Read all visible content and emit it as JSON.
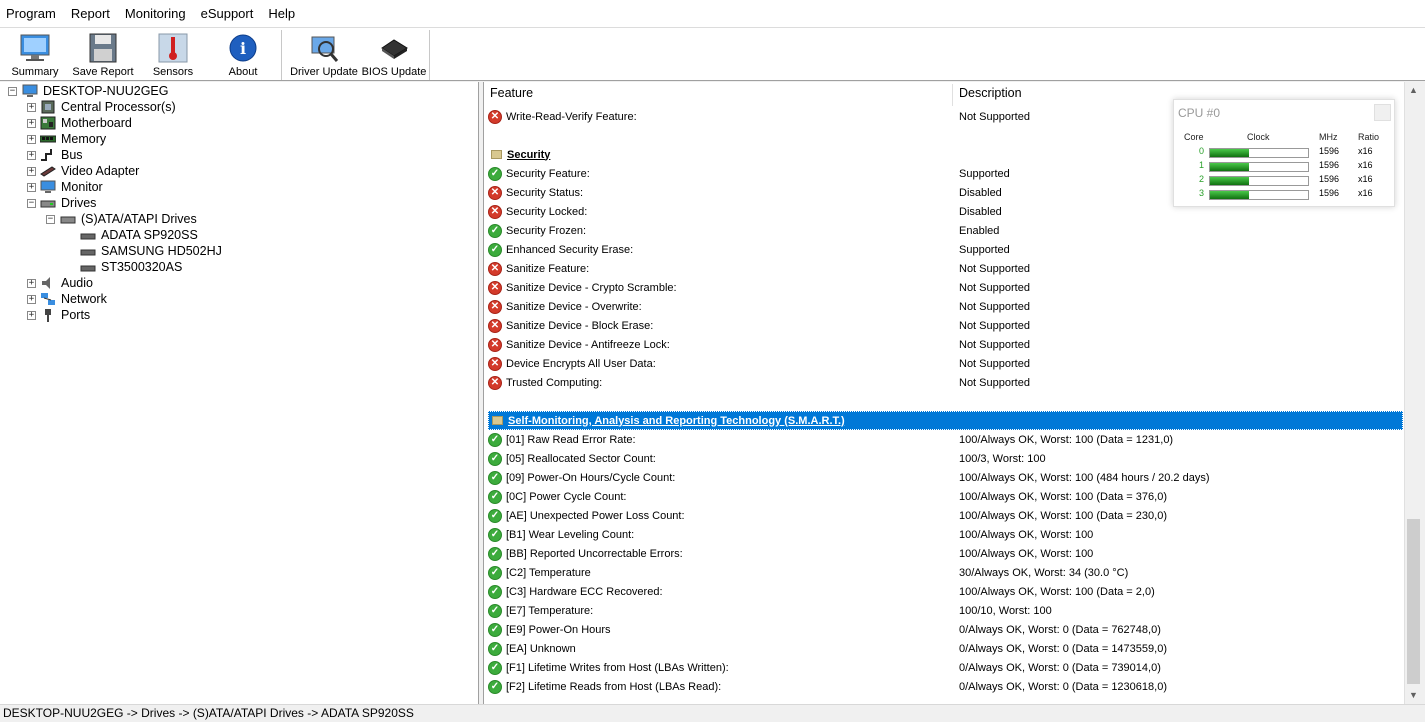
{
  "menu": [
    "Program",
    "Report",
    "Monitoring",
    "eSupport",
    "Help"
  ],
  "toolbar": {
    "summary": "Summary",
    "save_report": "Save Report",
    "sensors": "Sensors",
    "about": "About",
    "driver_update": "Driver Update",
    "bios_update": "BIOS Update"
  },
  "tree": {
    "root": "DESKTOP-NUU2GEG",
    "items": [
      "Central Processor(s)",
      "Motherboard",
      "Memory",
      "Bus",
      "Video Adapter",
      "Monitor",
      "Drives",
      "Audio",
      "Network",
      "Ports"
    ],
    "drives_group": "(S)ATA/ATAPI Drives",
    "drives": [
      "ADATA SP920SS",
      "SAMSUNG HD502HJ",
      "ST3500320AS"
    ]
  },
  "detail": {
    "col_feature": "Feature",
    "col_description": "Description",
    "rows": [
      {
        "status": "bad",
        "feature": "Write-Read-Verify Feature:",
        "description": "Not Supported"
      },
      {
        "status": "section",
        "feature": "Security",
        "description": ""
      },
      {
        "status": "ok",
        "feature": "Security Feature:",
        "description": "Supported"
      },
      {
        "status": "bad",
        "feature": "Security Status:",
        "description": "Disabled"
      },
      {
        "status": "bad",
        "feature": "Security Locked:",
        "description": "Disabled"
      },
      {
        "status": "ok",
        "feature": "Security Frozen:",
        "description": "Enabled"
      },
      {
        "status": "ok",
        "feature": "Enhanced Security Erase:",
        "description": "Supported"
      },
      {
        "status": "bad",
        "feature": "Sanitize Feature:",
        "description": "Not Supported"
      },
      {
        "status": "bad",
        "feature": "Sanitize Device - Crypto Scramble:",
        "description": "Not Supported"
      },
      {
        "status": "bad",
        "feature": "Sanitize Device - Overwrite:",
        "description": "Not Supported"
      },
      {
        "status": "bad",
        "feature": "Sanitize Device - Block Erase:",
        "description": "Not Supported"
      },
      {
        "status": "bad",
        "feature": "Sanitize Device - Antifreeze Lock:",
        "description": "Not Supported"
      },
      {
        "status": "bad",
        "feature": "Device Encrypts All User Data:",
        "description": "Not Supported"
      },
      {
        "status": "bad",
        "feature": "Trusted Computing:",
        "description": "Not Supported"
      },
      {
        "status": "section-selected",
        "feature": "Self-Monitoring, Analysis and Reporting Technology (S.M.A.R.T.)",
        "description": ""
      },
      {
        "status": "ok",
        "feature": "[01] Raw Read Error Rate:",
        "description": "100/Always OK, Worst: 100 (Data = 1231,0)"
      },
      {
        "status": "ok",
        "feature": "[05] Reallocated Sector Count:",
        "description": "100/3, Worst: 100"
      },
      {
        "status": "ok",
        "feature": "[09] Power-On Hours/Cycle Count:",
        "description": "100/Always OK, Worst: 100 (484 hours / 20.2 days)"
      },
      {
        "status": "ok",
        "feature": "[0C] Power Cycle Count:",
        "description": "100/Always OK, Worst: 100 (Data = 376,0)"
      },
      {
        "status": "ok",
        "feature": "[AE] Unexpected Power Loss Count:",
        "description": "100/Always OK, Worst: 100 (Data = 230,0)"
      },
      {
        "status": "ok",
        "feature": "[B1] Wear Leveling Count:",
        "description": "100/Always OK, Worst: 100"
      },
      {
        "status": "ok",
        "feature": "[BB] Reported Uncorrectable Errors:",
        "description": "100/Always OK, Worst: 100"
      },
      {
        "status": "ok",
        "feature": "[C2] Temperature",
        "description": "30/Always OK, Worst: 34 (30.0 °C)"
      },
      {
        "status": "ok",
        "feature": "[C3] Hardware ECC Recovered:",
        "description": "100/Always OK, Worst: 100 (Data = 2,0)"
      },
      {
        "status": "ok",
        "feature": "[E7] Temperature:",
        "description": "100/10, Worst: 100"
      },
      {
        "status": "ok",
        "feature": "[E9] Power-On Hours",
        "description": "0/Always OK, Worst: 0 (Data = 762748,0)"
      },
      {
        "status": "ok",
        "feature": "[EA] Unknown",
        "description": "0/Always OK, Worst: 0 (Data = 1473559,0)"
      },
      {
        "status": "ok",
        "feature": "[F1] Lifetime Writes from Host (LBAs Written):",
        "description": "0/Always OK, Worst: 0 (Data = 739014,0)"
      },
      {
        "status": "ok",
        "feature": "[F2] Lifetime Reads from Host (LBAs Read):",
        "description": "0/Always OK, Worst: 0 (Data = 1230618,0)"
      }
    ]
  },
  "cpu_panel": {
    "title": "CPU #0",
    "headers": {
      "core": "Core",
      "clock": "Clock",
      "mhz": "MHz",
      "ratio": "Ratio"
    },
    "cores": [
      {
        "core": "0",
        "mhz": "1596",
        "ratio": "x16",
        "clock_fraction": 0.4
      },
      {
        "core": "1",
        "mhz": "1596",
        "ratio": "x16",
        "clock_fraction": 0.4
      },
      {
        "core": "2",
        "mhz": "1596",
        "ratio": "x16",
        "clock_fraction": 0.4
      },
      {
        "core": "3",
        "mhz": "1596",
        "ratio": "x16",
        "clock_fraction": 0.4
      }
    ]
  },
  "status_bar": "DESKTOP-NUU2GEG -> Drives -> (S)ATA/ATAPI Drives -> ADATA SP920SS"
}
